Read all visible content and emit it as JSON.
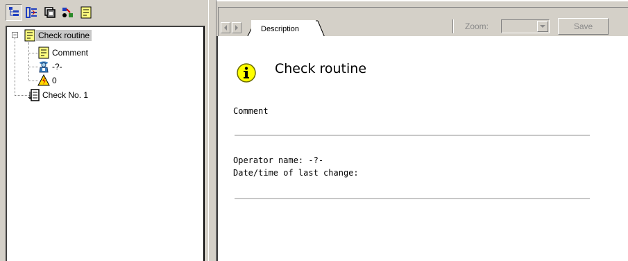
{
  "toolbar": {
    "buttons": [
      {
        "icon": "tree-view-icon",
        "active": true
      },
      {
        "icon": "flow-view-icon",
        "active": false
      },
      {
        "icon": "module-view-icon",
        "active": false
      },
      {
        "icon": "sensor-view-icon",
        "active": false
      },
      {
        "icon": "comment-view-icon",
        "active": false
      }
    ]
  },
  "tree": {
    "root": {
      "label": "Check routine",
      "icon": "note-icon",
      "expander": "−",
      "selected": true
    },
    "children": [
      {
        "label": "Comment",
        "icon": "note-icon"
      },
      {
        "label": "-?-",
        "icon": "operator-icon"
      },
      {
        "label": "0",
        "icon": "warning-icon"
      }
    ],
    "sibling": {
      "label": "Check No. 1",
      "icon": "check-list-icon"
    }
  },
  "header": {
    "tab_label": "Description",
    "zoom_label": "Zoom:",
    "zoom_value": "",
    "save_label": "Save"
  },
  "content": {
    "title": "Check routine",
    "comment_label": "Comment",
    "operator_line": "Operator name: -?-",
    "date_line": "Date/time of last change:"
  },
  "colors": {
    "face": "#d4d0c8",
    "note_yellow": "#ffff80",
    "info_yellow": "#ffff00",
    "disabled_text": "#8a8a8a"
  }
}
